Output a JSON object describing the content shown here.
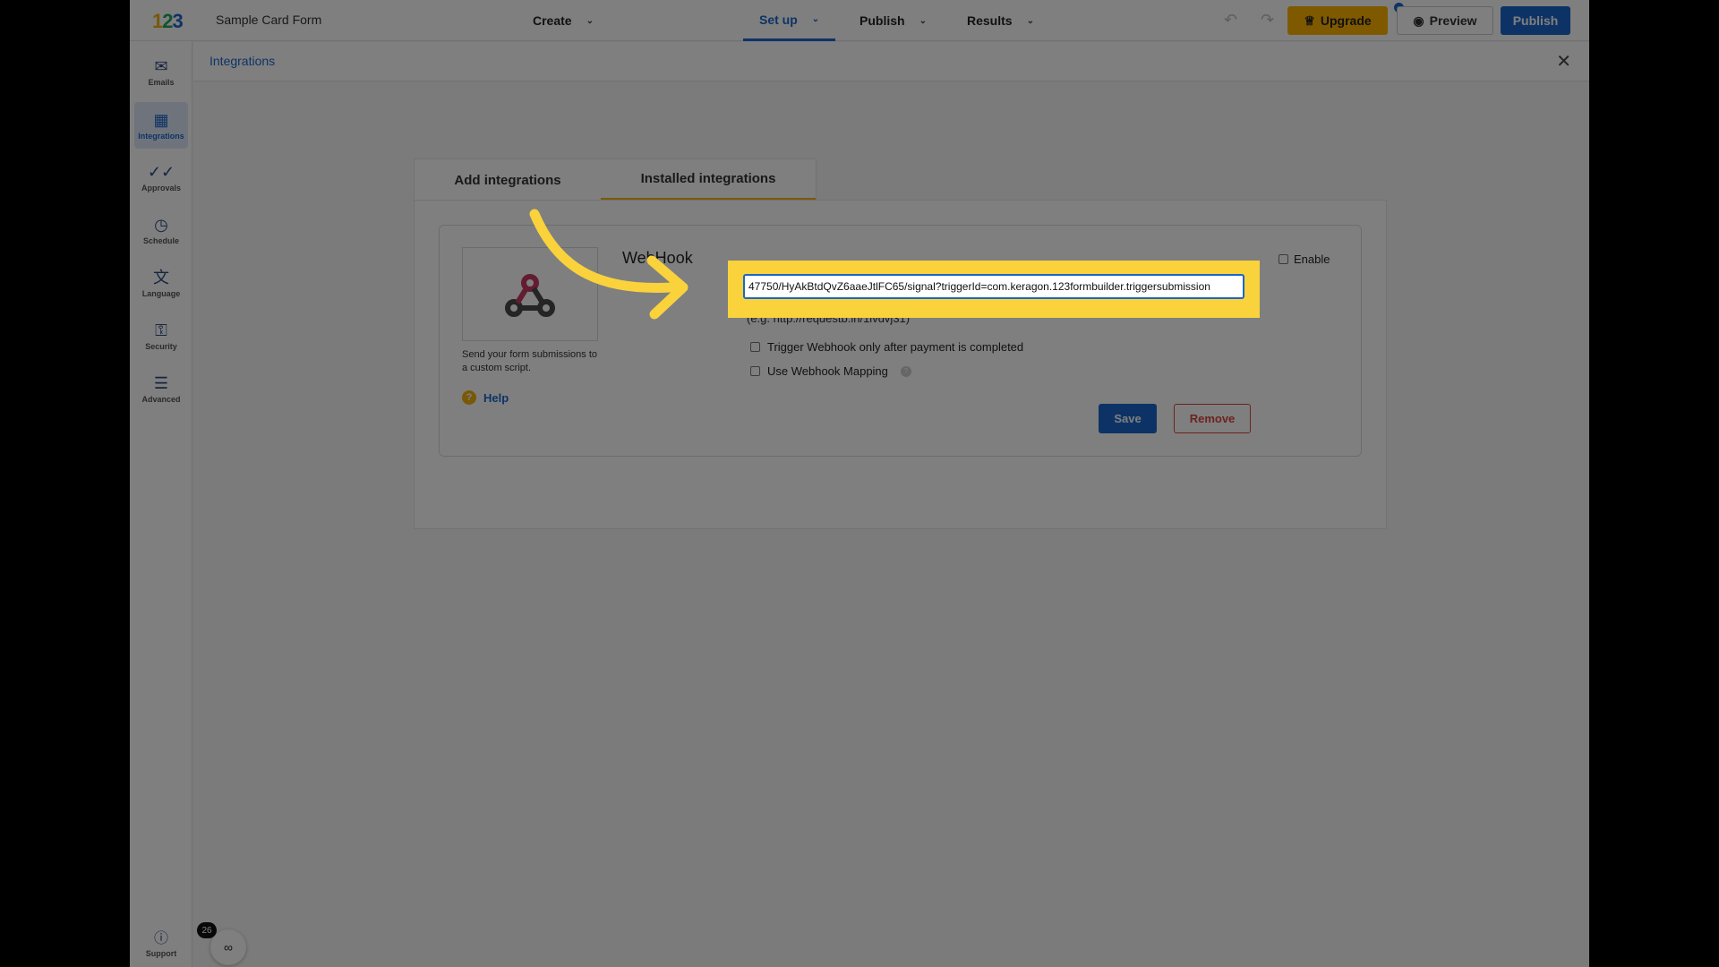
{
  "app": {
    "form_name": "Sample Card Form",
    "logo_text": "123"
  },
  "topnav": {
    "create": "Create",
    "setup": "Set up",
    "publish_menu": "Publish",
    "results": "Results",
    "upgrade_label": "Upgrade",
    "preview_label": "Preview",
    "publish_label": "Publish"
  },
  "sidebar": {
    "items": [
      {
        "label": "Emails",
        "icon": "envelope-icon"
      },
      {
        "label": "Integrations",
        "icon": "integrations-icon"
      },
      {
        "label": "Approvals",
        "icon": "double-check-icon"
      },
      {
        "label": "Schedule",
        "icon": "clock-icon"
      },
      {
        "label": "Language",
        "icon": "translate-icon"
      },
      {
        "label": "Security",
        "icon": "lock-icon"
      },
      {
        "label": "Advanced",
        "icon": "lines-icon"
      }
    ],
    "support_label": "Support"
  },
  "panel": {
    "title": "Integrations",
    "tabs": [
      {
        "label": "Add integrations",
        "active": false
      },
      {
        "label": "Installed integrations",
        "active": true
      }
    ]
  },
  "webhook": {
    "title": "WebHook",
    "description": "Send your form submissions to a custom script.",
    "help_label": "Help",
    "url_value": "47750/HyAkBtdQvZ6aaeJtlFC65/signal?triggerId=com.keragon.123formbuilder.triggersubmission",
    "url_hint": "(e.g. http://requestb.in/1ivdvj31)",
    "option_payment": "Trigger Webhook only after payment is completed",
    "option_mapping": "Use Webhook Mapping",
    "enable_label": "Enable",
    "save_label": "Save",
    "remove_label": "Remove"
  },
  "misc": {
    "badge_count": "26"
  },
  "colors": {
    "accent": "#1a66cc",
    "upgrade": "#ffb300",
    "highlight": "#f9d23c",
    "remove": "#d9473a"
  }
}
